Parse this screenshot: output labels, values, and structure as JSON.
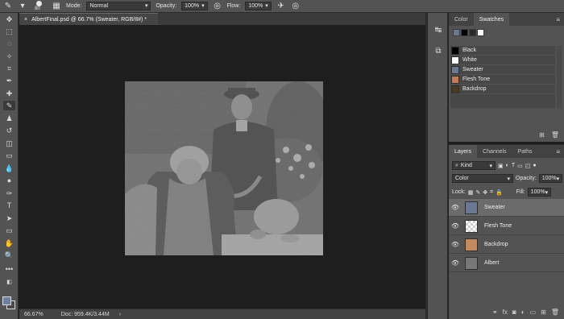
{
  "options_bar": {
    "brush_size": "80",
    "mode_label": "Mode:",
    "mode_value": "Normal",
    "opacity_label": "Opacity:",
    "opacity_value": "100%",
    "flow_label": "Flow:",
    "flow_value": "100%"
  },
  "document": {
    "tab_title": "AlbertFinal.psd @ 66.7% (Sweater, RGB/8#) *",
    "close_glyph": "×"
  },
  "status_bar": {
    "zoom": "66.67%",
    "doc_info": "Doc: 959.4K/3.44M",
    "arrow": "›"
  },
  "swatches_panel": {
    "tabs": [
      "Color",
      "Swatches"
    ],
    "active_tab": "Swatches",
    "chips": [
      "#6b7893",
      "#000000",
      "#2b2b2b",
      "#ffffff"
    ],
    "items": [
      {
        "label": "Black",
        "color": "#000000"
      },
      {
        "label": "White",
        "color": "#ffffff"
      },
      {
        "label": "Sweater",
        "color": "#6b7893"
      },
      {
        "label": "Flesh Tone",
        "color": "#c47a52"
      },
      {
        "label": "Backdrop",
        "color": "#4a3a22"
      }
    ]
  },
  "layers_panel": {
    "tabs": [
      "Layers",
      "Channels",
      "Paths"
    ],
    "active_tab": "Layers",
    "kind_label": "Kind",
    "blend_mode": "Color",
    "opacity_label": "Opacity:",
    "opacity_value": "100%",
    "lock_label": "Lock:",
    "fill_label": "Fill:",
    "fill_value": "100%",
    "layers": [
      {
        "name": "Sweater",
        "selected": true
      },
      {
        "name": "Flesh Tone",
        "selected": false
      },
      {
        "name": "Backdrop",
        "selected": false
      },
      {
        "name": "Albert",
        "selected": false
      }
    ]
  }
}
